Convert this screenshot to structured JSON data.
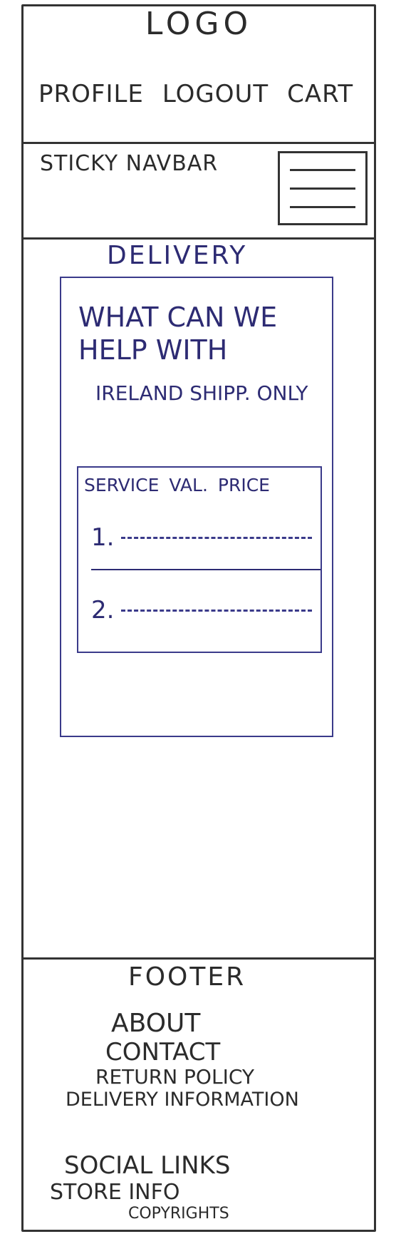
{
  "header": {
    "logo": "LOGO",
    "links": [
      "PROFILE",
      "LOGOUT",
      "CART"
    ]
  },
  "navbar": {
    "label": "STICKY NAVBAR",
    "menu_icon": "hamburger-menu-icon"
  },
  "main": {
    "title": "DELIVERY",
    "card": {
      "heading": "WHAT CAN WE HELP WITH",
      "note": "IRELAND SHIPP. ONLY",
      "table": {
        "headers": [
          "SERVICE",
          "VAL.",
          "PRICE"
        ],
        "rows": [
          "1.",
          "2."
        ]
      }
    }
  },
  "footer": {
    "title": "FOOTER",
    "links": [
      "ABOUT",
      "CONTACT",
      "RETURN POLICY",
      "DELIVERY INFORMATION"
    ],
    "social": "SOCIAL LINKS",
    "store_info": "STORE INFO",
    "copyright": "COPYRIGHTS"
  },
  "colors": {
    "pencil": "#333333",
    "ink_blue": "#2d2b73"
  }
}
